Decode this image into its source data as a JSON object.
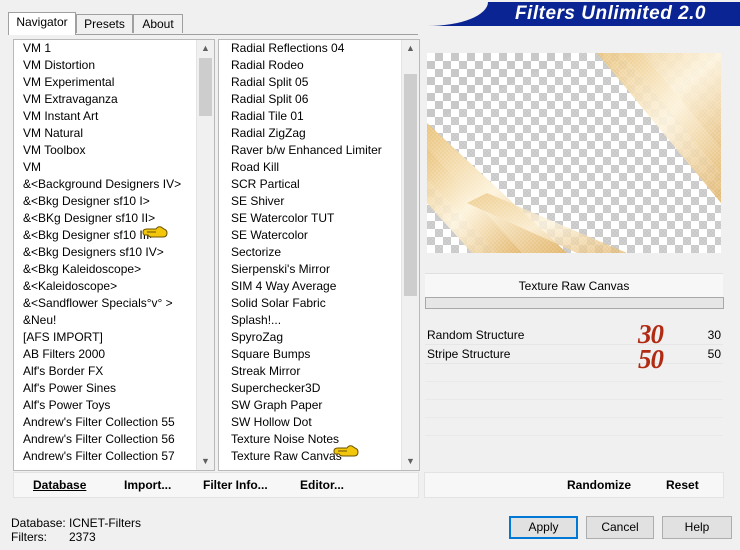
{
  "tabs": [
    {
      "label": "Navigator",
      "active": true
    },
    {
      "label": "Presets",
      "active": false
    },
    {
      "label": "About",
      "active": false
    }
  ],
  "title": "Filters Unlimited 2.0",
  "categories": [
    "VM 1",
    "VM Distortion",
    "VM Experimental",
    "VM Extravaganza",
    "VM Instant Art",
    "VM Natural",
    "VM Toolbox",
    "VM",
    "&<Background Designers IV>",
    "&<Bkg Designer sf10 I>",
    "&<BKg Designer sf10 II>",
    "&<Bkg Designer sf10 III>",
    "&<Bkg Designers sf10 IV>",
    "&<Bkg Kaleidoscope>",
    "&<Kaleidoscope>",
    "&<Sandflower Specials°v° >",
    "&Neu!",
    "[AFS IMPORT]",
    "AB Filters 2000",
    "Alf's Border FX",
    "Alf's Power Sines",
    "Alf's Power Toys",
    "Andrew's Filter Collection 55",
    "Andrew's Filter Collection 56",
    "Andrew's Filter Collection 57"
  ],
  "filters": [
    "Radial Reflections 04",
    "Radial Rodeo",
    "Radial Split 05",
    "Radial Split 06",
    "Radial Tile 01",
    "Radial ZigZag",
    "Raver b/w Enhanced Limiter",
    "Road Kill",
    "SCR  Partical",
    "SE Shiver",
    "SE Watercolor TUT",
    "SE Watercolor",
    "Sectorize",
    "Sierpenski's Mirror",
    "SIM 4 Way Average",
    "Solid Solar Fabric",
    "Splash!...",
    "SpyroZag",
    "Square Bumps",
    "Streak Mirror",
    "Superchecker3D",
    "SW Graph Paper",
    "SW Hollow Dot",
    "Texture Noise Notes",
    "Texture Raw Canvas"
  ],
  "selected_filter": "Texture Raw Canvas",
  "params": [
    {
      "label": "Random Structure",
      "value": "30"
    },
    {
      "label": "Stripe Structure",
      "value": "50"
    }
  ],
  "annotation": {
    "line1": "30",
    "line2": "50"
  },
  "buttons": {
    "database": "Database",
    "import": "Import...",
    "filter_info": "Filter Info...",
    "editor": "Editor...",
    "randomize": "Randomize",
    "reset": "Reset",
    "apply": "Apply",
    "cancel": "Cancel",
    "help": "Help"
  },
  "status": {
    "database_label": "Database:",
    "database_value": "ICNET-Filters",
    "filters_label": "Filters:",
    "filters_value": "2373"
  },
  "colors": {
    "banner": "#0a2493",
    "annotation": "#b12a12",
    "pointer": "#f2c60a",
    "default_button_border": "#0078d7"
  },
  "icons": {
    "pointer": "pointing-hand-icon",
    "scroll_up": "chevron-up-icon",
    "scroll_down": "chevron-down-icon"
  }
}
